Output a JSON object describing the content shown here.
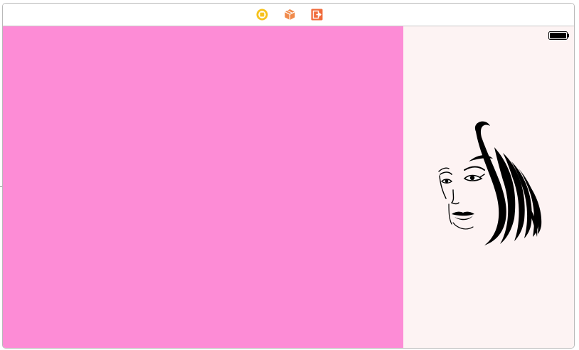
{
  "scene_dock": {
    "icons": [
      {
        "name": "view-controller-icon",
        "color": "#f6c21c"
      },
      {
        "name": "first-responder-icon",
        "color": "#f08a4b"
      },
      {
        "name": "exit-icon",
        "color": "#f06b3b"
      }
    ]
  },
  "canvas": {
    "left_panel_color": "#fd8cd6",
    "right_panel_color": "#fdf3f3",
    "status_bar": {
      "battery_icon": "battery-full-icon"
    },
    "artwork": "woman-face-silhouette"
  }
}
